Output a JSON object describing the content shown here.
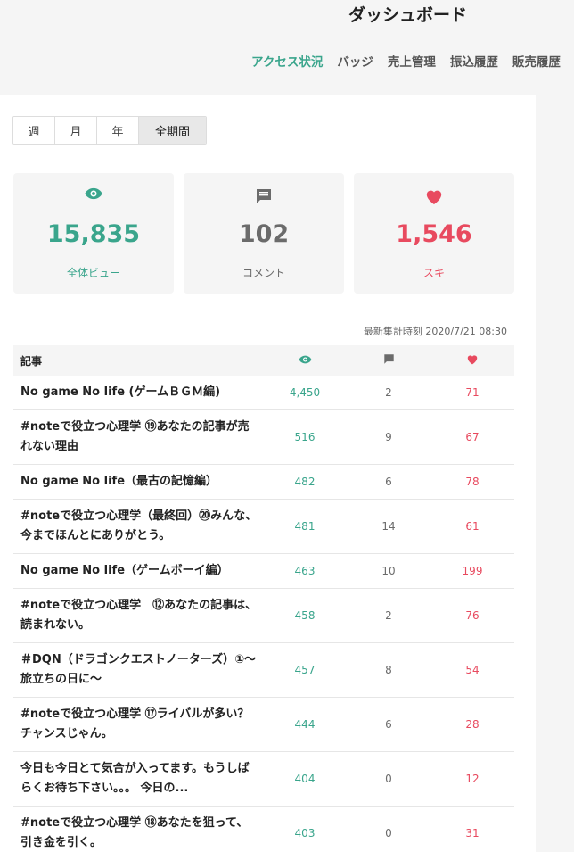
{
  "header": {
    "title": "ダッシュボード"
  },
  "tabs": [
    {
      "label": "アクセス状況",
      "active": true
    },
    {
      "label": "バッジ",
      "active": false
    },
    {
      "label": "売上管理",
      "active": false
    },
    {
      "label": "振込履歴",
      "active": false
    },
    {
      "label": "販売履歴",
      "active": false
    }
  ],
  "range": [
    {
      "label": "週",
      "active": false
    },
    {
      "label": "月",
      "active": false
    },
    {
      "label": "年",
      "active": false
    },
    {
      "label": "全期間",
      "active": true
    }
  ],
  "stats": {
    "views": {
      "value": "15,835",
      "label": "全体ビュー",
      "icon": "eye-icon",
      "color": "#3aa58c"
    },
    "comments": {
      "value": "102",
      "label": "コメント",
      "icon": "comment-icon",
      "color": "#6b6b6b"
    },
    "likes": {
      "value": "1,546",
      "label": "スキ",
      "icon": "heart-icon",
      "color": "#e84a5f"
    }
  },
  "updated_at": "最新集計時刻 2020/7/21 08:30",
  "table": {
    "header_article": "記事",
    "rows": [
      {
        "title": "No game No life (ゲームＢＧＭ編)",
        "views": "4,450",
        "comments": "2",
        "likes": "71"
      },
      {
        "title": "#noteで役立つ心理学 ⑲あなたの記事が売れない理由",
        "views": "516",
        "comments": "9",
        "likes": "67"
      },
      {
        "title": "No game No life（最古の記憶編）",
        "views": "482",
        "comments": "6",
        "likes": "78"
      },
      {
        "title": "#noteで役立つ心理学（最終回）⑳みんな、今までほんとにありがとう。",
        "views": "481",
        "comments": "14",
        "likes": "61"
      },
      {
        "title": "No game No life（ゲームボーイ編）",
        "views": "463",
        "comments": "10",
        "likes": "199"
      },
      {
        "title": "#noteで役立つ心理学　⑫あなたの記事は、読まれない。",
        "views": "458",
        "comments": "2",
        "likes": "76"
      },
      {
        "title": "＃DQN（ドラゴンクエストノーターズ）①～旅立ちの日に～",
        "views": "457",
        "comments": "8",
        "likes": "54"
      },
      {
        "title": "#noteで役立つ心理学 ⑰ライバルが多い？チャンスじゃん。",
        "views": "444",
        "comments": "6",
        "likes": "28"
      },
      {
        "title": "今日も今日とて気合が入ってます。もうしばらくお待ち下さい。。。 今日の...",
        "views": "404",
        "comments": "0",
        "likes": "12"
      },
      {
        "title": "#noteで役立つ心理学 ⑱あなたを狙って、引き金を引く。",
        "views": "403",
        "comments": "0",
        "likes": "31"
      }
    ]
  }
}
